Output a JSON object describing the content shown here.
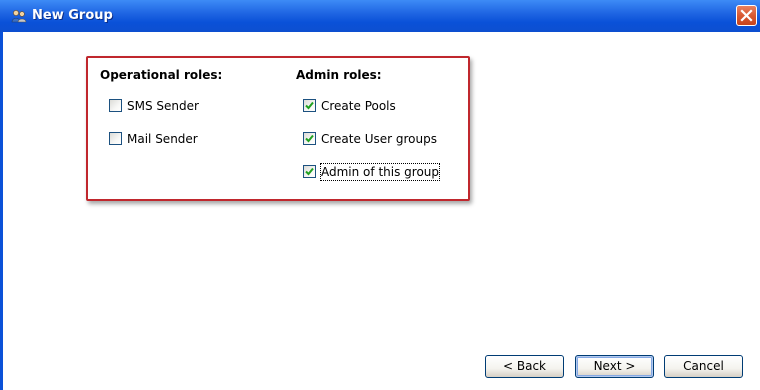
{
  "window": {
    "title": "New Group",
    "icon": "group-icon",
    "close_icon": "close-icon"
  },
  "roles": {
    "operational": {
      "heading": "Operational roles:",
      "items": [
        {
          "label": "SMS Sender",
          "checked": false
        },
        {
          "label": "Mail Sender",
          "checked": false
        }
      ]
    },
    "admin": {
      "heading": "Admin roles:",
      "items": [
        {
          "label": "Create Pools",
          "checked": true
        },
        {
          "label": "Create User groups",
          "checked": true
        },
        {
          "label": "Admin of this group",
          "checked": true
        }
      ]
    }
  },
  "buttons": {
    "back": "< Back",
    "next": "Next >",
    "cancel": "Cancel"
  },
  "colors": {
    "titlebar": "#0a51d8",
    "highlight_border": "#c0272d",
    "checkmark": "#21a121",
    "close_button": "#d95a33"
  }
}
